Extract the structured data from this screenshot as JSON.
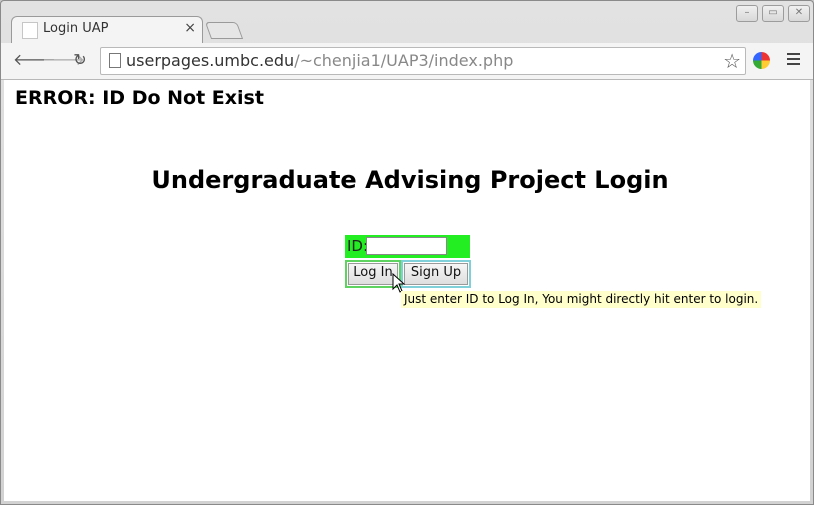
{
  "browser": {
    "tab_title": "Login UAP",
    "tab_close": "×",
    "url_domain": "userpages.umbc.edu",
    "url_path": "/~chenjia1/UAP3/index.php"
  },
  "page": {
    "error_message": "ERROR: ID Do Not Exist",
    "heading": "Undergraduate Advising Project Login",
    "id_label": "ID:",
    "id_value": "",
    "login_label": "Log In",
    "signup_label": "Sign Up",
    "tooltip": "Just enter ID to Log In, You might directly hit enter to login."
  },
  "colors": {
    "form_highlight": "#22ee22",
    "tooltip_bg": "#ffffcc"
  }
}
